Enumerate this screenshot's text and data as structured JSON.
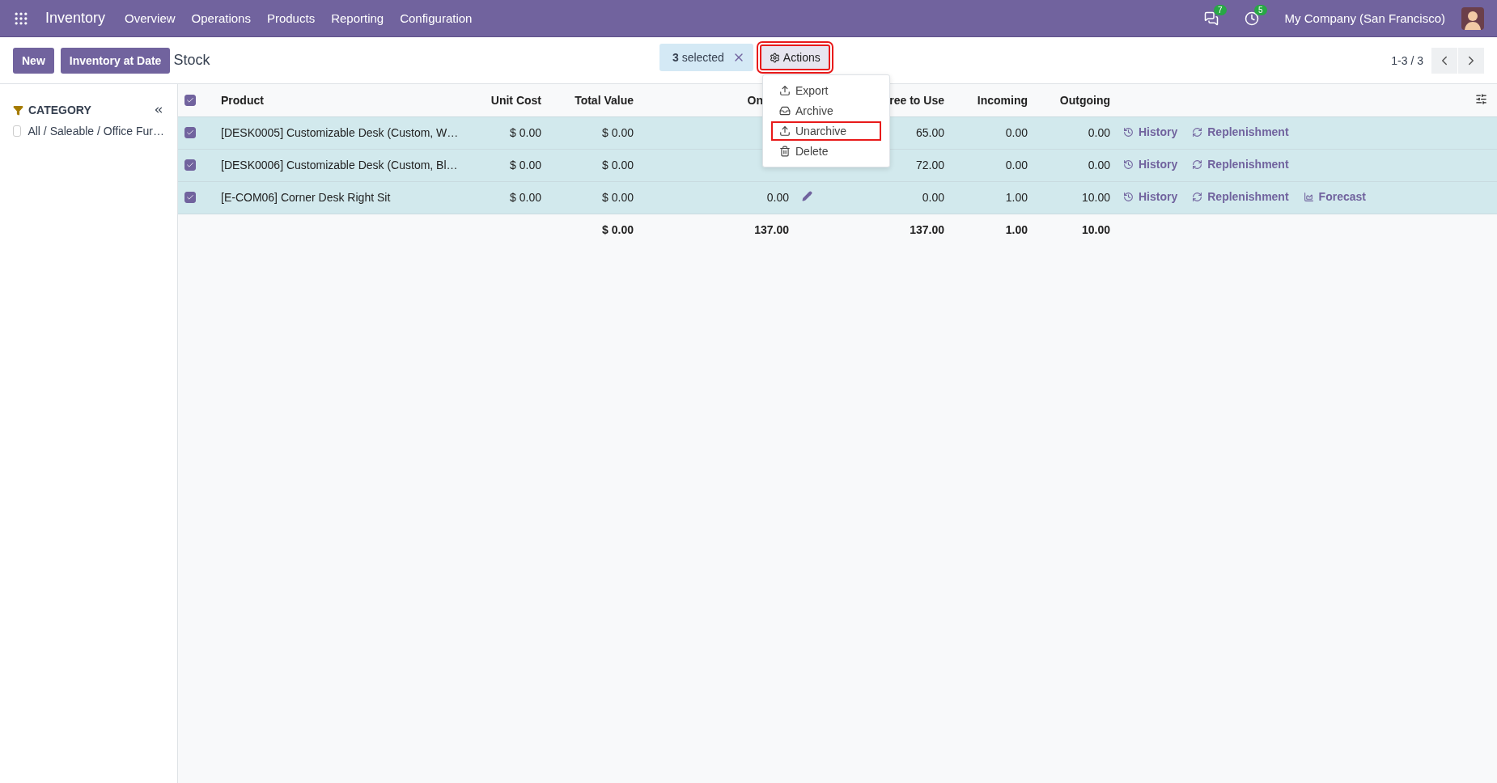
{
  "navbar": {
    "app": "Inventory",
    "menu": [
      "Overview",
      "Operations",
      "Products",
      "Reporting",
      "Configuration"
    ],
    "messages_badge": "7",
    "activities_badge": "5",
    "company": "My Company (San Francisco)"
  },
  "control_panel": {
    "buttons": [
      "New",
      "Inventory at Date"
    ],
    "breadcrumb": "Stock",
    "selection": {
      "count": "3",
      "label": "selected"
    },
    "actions": {
      "label": "Actions",
      "highlighted": true
    },
    "pager": "1-3 / 3"
  },
  "actions_menu": [
    {
      "kind": "export",
      "label": "Export",
      "highlighted": false
    },
    {
      "kind": "archive",
      "label": "Archive",
      "highlighted": false
    },
    {
      "kind": "unarchive",
      "label": "Unarchive",
      "highlighted": true
    },
    {
      "kind": "delete",
      "label": "Delete",
      "highlighted": false
    }
  ],
  "sidebar": {
    "title": "CATEGORY",
    "items": [
      {
        "label": "All / Saleable / Office Fur…",
        "checked": false
      }
    ]
  },
  "table": {
    "all_checked": true,
    "columns": [
      "Product",
      "Unit Cost",
      "Total Value",
      "On",
      "ree to Use",
      "Incoming",
      "Outgoing"
    ],
    "rows": [
      {
        "selected": true,
        "product": "[DESK0005] Customizable Desk (Custom, W…",
        "unit_cost": "$ 0.00",
        "total_value": "$ 0.00",
        "free": "65.00",
        "incoming": "0.00",
        "outgoing": "0.00",
        "links": [
          {
            "kind": "history",
            "label": "History"
          },
          {
            "kind": "replenishment",
            "label": "Replenishment"
          }
        ]
      },
      {
        "selected": true,
        "product": "[DESK0006] Customizable Desk (Custom, Bl…",
        "unit_cost": "$ 0.00",
        "total_value": "$ 0.00",
        "free": "72.00",
        "incoming": "0.00",
        "outgoing": "0.00",
        "links": [
          {
            "kind": "history",
            "label": "History"
          },
          {
            "kind": "replenishment",
            "label": "Replenishment"
          }
        ]
      },
      {
        "selected": true,
        "product": "[E-COM06] Corner Desk Right Sit",
        "unit_cost": "$ 0.00",
        "total_value": "$ 0.00",
        "on_hand": "0.00",
        "free": "0.00",
        "incoming": "1.00",
        "outgoing": "10.00",
        "links": [
          {
            "kind": "history",
            "label": "History"
          },
          {
            "kind": "replenishment",
            "label": "Replenishment"
          },
          {
            "kind": "forecast",
            "label": "Forecast"
          }
        ]
      }
    ],
    "totals": {
      "total_value": "$ 0.00",
      "on_hand": "137.00",
      "free": "137.00",
      "incoming": "1.00",
      "outgoing": "10.00"
    }
  }
}
